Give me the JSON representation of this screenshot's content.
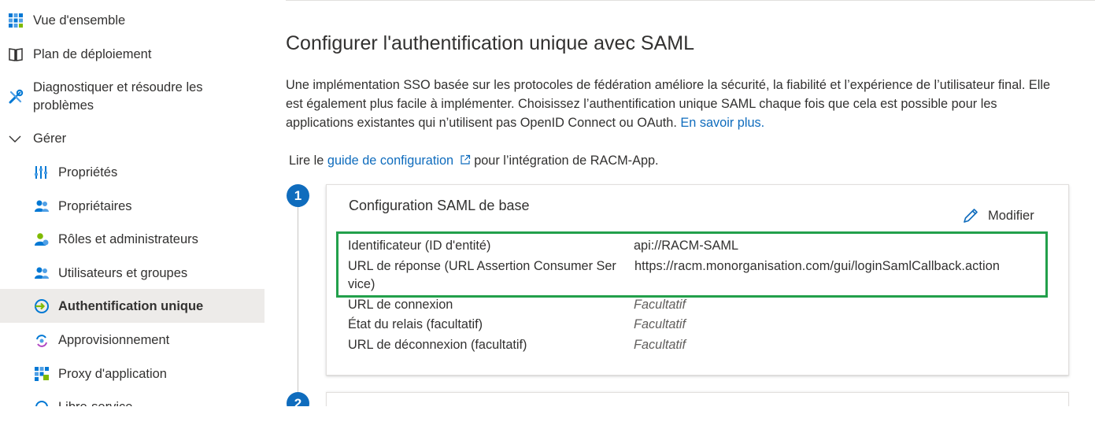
{
  "sidebar": {
    "items": [
      {
        "label": "Vue d'ensemble",
        "icon": "grid-icon"
      },
      {
        "label": "Plan de déploiement",
        "icon": "book-icon"
      },
      {
        "label": "Diagnostiquer et résoudre les",
        "label2": "problèmes",
        "icon": "wrench-icon"
      },
      {
        "label": "Gérer",
        "icon": "chevron-down-icon"
      },
      {
        "label": "Propriétés",
        "icon": "properties-icon"
      },
      {
        "label": "Propriétaires",
        "icon": "owners-icon"
      },
      {
        "label": "Rôles et administrateurs",
        "icon": "roles-icon"
      },
      {
        "label": "Utilisateurs et groupes",
        "icon": "users-icon"
      },
      {
        "label": "Authentification unique",
        "icon": "sso-icon"
      },
      {
        "label": "Approvisionnement",
        "icon": "provisioning-icon"
      },
      {
        "label": "Proxy d'application",
        "icon": "app-proxy-icon"
      },
      {
        "label": "Libre-service",
        "icon": "self-service-icon"
      }
    ]
  },
  "main": {
    "title": "Configurer l'authentification unique avec SAML",
    "intro_line1": "Une implémentation SSO basée sur les protocoles de fédération améliore la sécurité, la fiabilité et l’expérience de l’utilisateur final. Elle",
    "intro_line2": "est également plus facile à implémenter. Choisissez l’authentification unique SAML chaque fois que cela est possible pour les",
    "intro_line3": "applications existantes qui n’utilisent pas OpenID Connect ou OAuth.",
    "learn_more": "En savoir plus.",
    "guide_prefix": "Lire le",
    "guide_link": "guide de configuration",
    "guide_suffix": "pour l’intégration de RACM-App."
  },
  "steps": [
    "1",
    "2"
  ],
  "card": {
    "title": "Configuration SAML de base",
    "edit_label": "Modifier",
    "rows": [
      {
        "label": "Identificateur (ID d'entité)",
        "value": "api://RACM-SAML"
      },
      {
        "label": "URL de réponse (URL Assertion Consumer Ser",
        "label2": "vice)",
        "value": "https://racm.monorganisation.com/gui/loginSamlCallback.action"
      },
      {
        "label": "URL de connexion",
        "value": "Facultatif"
      },
      {
        "label": "État du relais (facultatif)",
        "value": "Facultatif"
      },
      {
        "label": "URL de déconnexion (facultatif)",
        "value": "Facultatif"
      }
    ]
  },
  "colors": {
    "accent": "#0f6cbd",
    "highlight": "#22a04b",
    "active_bg": "#edebe9"
  }
}
